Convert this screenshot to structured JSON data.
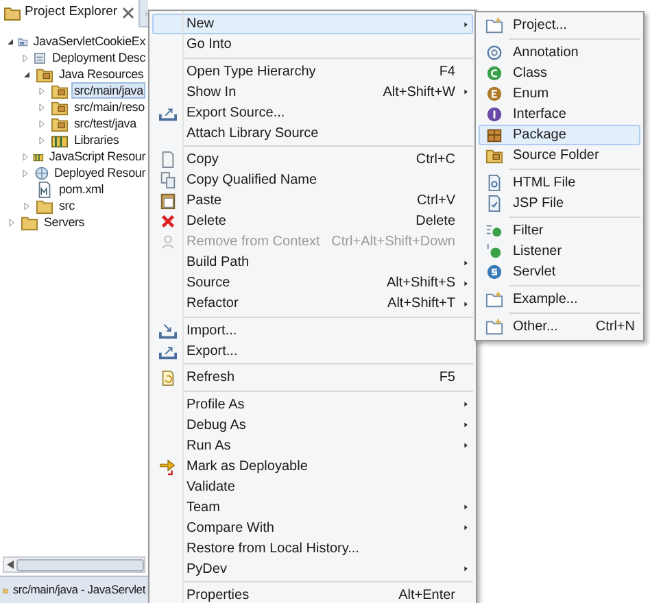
{
  "explorer": {
    "title": "Project Explorer",
    "tree": [
      {
        "label": "JavaServletCookieEx",
        "kind": "project",
        "expanded": true,
        "selected": false,
        "children": [
          {
            "label": "Deployment Desc",
            "kind": "descriptor",
            "expanded": false,
            "selected": false
          },
          {
            "label": "Java Resources",
            "kind": "source_folder",
            "expanded": true,
            "selected": false,
            "children": [
              {
                "label": "src/main/java",
                "kind": "source_folder",
                "expanded": false,
                "selected": true
              },
              {
                "label": "src/main/reso",
                "kind": "source_folder",
                "expanded": false,
                "selected": false
              },
              {
                "label": "src/test/java",
                "kind": "source_folder",
                "expanded": false,
                "selected": false
              },
              {
                "label": "Libraries",
                "kind": "library",
                "expanded": false,
                "selected": false
              }
            ]
          },
          {
            "label": "JavaScript Resour",
            "kind": "library",
            "expanded": false,
            "selected": false
          },
          {
            "label": "Deployed Resour",
            "kind": "globe",
            "expanded": false,
            "selected": false
          },
          {
            "label": "pom.xml",
            "kind": "file",
            "selected": false
          },
          {
            "label": "src",
            "kind": "folder",
            "expanded": false,
            "selected": false
          }
        ]
      },
      {
        "label": "Servers",
        "kind": "folder",
        "expanded": false,
        "selected": false
      }
    ]
  },
  "status_bar": {
    "text": "src/main/java - JavaServlet"
  },
  "context_menu": [
    {
      "kind": "item",
      "label": "New",
      "submenu": true,
      "selected": true,
      "disabled": false
    },
    {
      "kind": "item",
      "label": "Go Into",
      "submenu": false,
      "selected": false,
      "disabled": false
    },
    {
      "kind": "separator"
    },
    {
      "kind": "item",
      "label": "Open Type Hierarchy",
      "shortcut": "F4",
      "submenu": false,
      "selected": false,
      "disabled": false
    },
    {
      "kind": "item",
      "label": "Show In",
      "shortcut": "Alt+Shift+W",
      "submenu": true,
      "selected": false,
      "disabled": false
    },
    {
      "kind": "item",
      "label": "Export Source...",
      "submenu": false,
      "selected": false,
      "disabled": false
    },
    {
      "kind": "item",
      "label": "Attach Library Source",
      "submenu": false,
      "selected": false,
      "disabled": false
    },
    {
      "kind": "separator"
    },
    {
      "kind": "item",
      "label": "Copy",
      "shortcut": "Ctrl+C",
      "submenu": false,
      "selected": false,
      "disabled": false
    },
    {
      "kind": "item",
      "label": "Copy Qualified Name",
      "submenu": false,
      "selected": false,
      "disabled": false
    },
    {
      "kind": "item",
      "label": "Paste",
      "shortcut": "Ctrl+V",
      "submenu": false,
      "selected": false,
      "disabled": false
    },
    {
      "kind": "item",
      "label": "Delete",
      "shortcut": "Delete",
      "submenu": false,
      "selected": false,
      "disabled": false
    },
    {
      "kind": "item",
      "label": "Remove from Context",
      "shortcut": "Ctrl+Alt+Shift+Down",
      "submenu": false,
      "selected": false,
      "disabled": true
    },
    {
      "kind": "item",
      "label": "Build Path",
      "submenu": true,
      "selected": false,
      "disabled": false
    },
    {
      "kind": "item",
      "label": "Source",
      "shortcut": "Alt+Shift+S",
      "submenu": true,
      "selected": false,
      "disabled": false
    },
    {
      "kind": "item",
      "label": "Refactor",
      "shortcut": "Alt+Shift+T",
      "submenu": true,
      "selected": false,
      "disabled": false
    },
    {
      "kind": "separator"
    },
    {
      "kind": "item",
      "label": "Import...",
      "submenu": false,
      "selected": false,
      "disabled": false
    },
    {
      "kind": "item",
      "label": "Export...",
      "submenu": false,
      "selected": false,
      "disabled": false
    },
    {
      "kind": "separator"
    },
    {
      "kind": "item",
      "label": "Refresh",
      "shortcut": "F5",
      "submenu": false,
      "selected": false,
      "disabled": false
    },
    {
      "kind": "separator"
    },
    {
      "kind": "item",
      "label": "Profile As",
      "submenu": true,
      "selected": false,
      "disabled": false
    },
    {
      "kind": "item",
      "label": "Debug As",
      "submenu": true,
      "selected": false,
      "disabled": false
    },
    {
      "kind": "item",
      "label": "Run As",
      "submenu": true,
      "selected": false,
      "disabled": false
    },
    {
      "kind": "item",
      "label": "Mark as Deployable",
      "submenu": false,
      "selected": false,
      "disabled": false
    },
    {
      "kind": "item",
      "label": "Validate",
      "submenu": false,
      "selected": false,
      "disabled": false
    },
    {
      "kind": "item",
      "label": "Team",
      "submenu": true,
      "selected": false,
      "disabled": false
    },
    {
      "kind": "item",
      "label": "Compare With",
      "submenu": true,
      "selected": false,
      "disabled": false
    },
    {
      "kind": "item",
      "label": "Restore from Local History...",
      "submenu": false,
      "selected": false,
      "disabled": false
    },
    {
      "kind": "item",
      "label": "PyDev",
      "submenu": true,
      "selected": false,
      "disabled": false
    },
    {
      "kind": "separator"
    },
    {
      "kind": "item",
      "label": "Properties",
      "shortcut": "Alt+Enter",
      "submenu": false,
      "selected": false,
      "disabled": false
    }
  ],
  "new_submenu": [
    {
      "kind": "item",
      "label": "Project...",
      "selected": false
    },
    {
      "kind": "separator"
    },
    {
      "kind": "item",
      "label": "Annotation",
      "selected": false
    },
    {
      "kind": "item",
      "label": "Class",
      "selected": false
    },
    {
      "kind": "item",
      "label": "Enum",
      "selected": false
    },
    {
      "kind": "item",
      "label": "Interface",
      "selected": false
    },
    {
      "kind": "item",
      "label": "Package",
      "selected": true
    },
    {
      "kind": "item",
      "label": "Source Folder",
      "selected": false
    },
    {
      "kind": "separator"
    },
    {
      "kind": "item",
      "label": "HTML File",
      "selected": false
    },
    {
      "kind": "item",
      "label": "JSP File",
      "selected": false
    },
    {
      "kind": "separator"
    },
    {
      "kind": "item",
      "label": "Filter",
      "selected": false
    },
    {
      "kind": "item",
      "label": "Listener",
      "selected": false
    },
    {
      "kind": "item",
      "label": "Servlet",
      "selected": false
    },
    {
      "kind": "separator"
    },
    {
      "kind": "item",
      "label": "Example...",
      "selected": false
    },
    {
      "kind": "separator"
    },
    {
      "kind": "item",
      "label": "Other...",
      "shortcut": "Ctrl+N",
      "selected": false
    }
  ]
}
